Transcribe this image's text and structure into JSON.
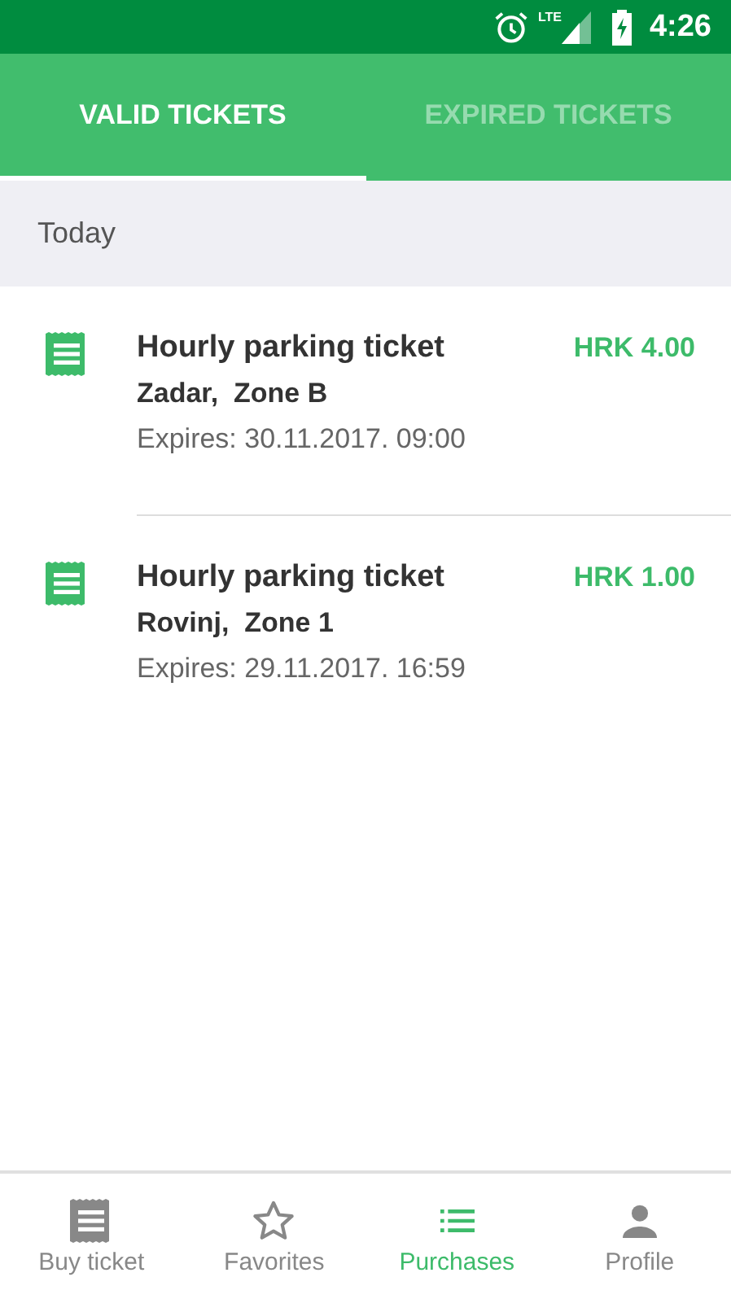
{
  "status_bar": {
    "time": "4:26",
    "network": "LTE"
  },
  "tabs": [
    {
      "label": "VALID TICKETS",
      "selected": true
    },
    {
      "label": "EXPIRED TICKETS",
      "selected": false
    }
  ],
  "section": {
    "title": "Today"
  },
  "tickets": [
    {
      "title": "Hourly parking ticket",
      "location": "Zadar,  Zone B",
      "expires": "Expires: 30.11.2017. 09:00",
      "price": "HRK 4.00"
    },
    {
      "title": "Hourly parking ticket",
      "location": "Rovinj,  Zone 1",
      "expires": "Expires: 29.11.2017. 16:59",
      "price": "HRK 1.00"
    }
  ],
  "bottom_nav": [
    {
      "label": "Buy ticket",
      "kind": "ticket",
      "selected": false
    },
    {
      "label": "Favorites",
      "kind": "star",
      "selected": false
    },
    {
      "label": "Purchases",
      "kind": "list",
      "selected": true
    },
    {
      "label": "Profile",
      "kind": "person",
      "selected": false
    }
  ]
}
